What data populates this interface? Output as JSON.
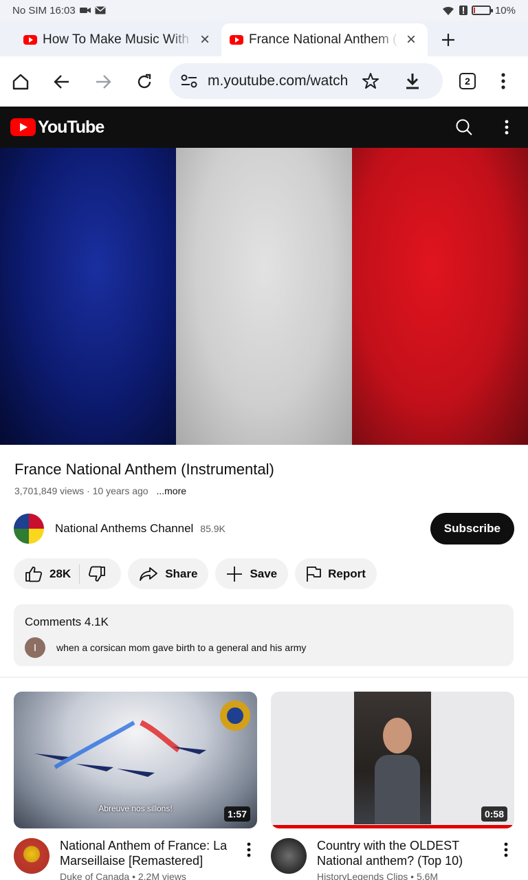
{
  "status_bar": {
    "carrier_time": "No SIM 16:03",
    "battery": "10%",
    "battery_level": 0.1
  },
  "tabs": [
    {
      "title": "How To Make Music With A",
      "active": false
    },
    {
      "title": "France National Anthem (In",
      "active": true
    }
  ],
  "toolbar": {
    "url": "m.youtube.com/watch",
    "tab_count": "2"
  },
  "youtube": {
    "logo_text": "YouTube"
  },
  "video": {
    "title": "France National Anthem (Instrumental)",
    "meta": "3,701,849 views · 10 years ago",
    "more_label": "...more",
    "flag_colors": [
      "#0c1a6e",
      "#d6d6d6",
      "#c2101a"
    ]
  },
  "channel": {
    "name": "National Anthems Channel",
    "subscribers": "85.9K",
    "subscribe_label": "Subscribe"
  },
  "actions": {
    "likes": "28K",
    "share": "Share",
    "save": "Save",
    "report": "Report"
  },
  "comments": {
    "header": "Comments 4.1K",
    "top_comment_initial": "I",
    "top_comment": "when a corsican mom gave birth to a general and his army"
  },
  "recommendations": [
    {
      "title": "National Anthem of France: La Marseillaise [Remastered]",
      "channel_meta": "Duke of Canada • 2.2M views",
      "duration": "1:57",
      "caption": "Abreuve nos sillons!"
    },
    {
      "title": "Country with the OLDEST National anthem? (Top 10)",
      "channel_meta": "HistoryLegends Clips • 5.6M",
      "duration": "0:58"
    }
  ]
}
